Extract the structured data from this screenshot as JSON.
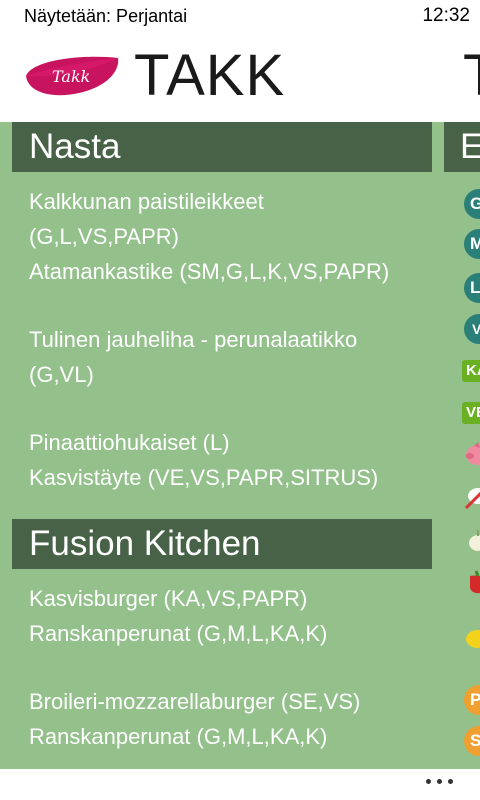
{
  "status_bar": {
    "left_text": "Näytetään: Perjantai",
    "time": "12:32"
  },
  "header": {
    "logo_text": "Takk",
    "title": "TAKK",
    "next_title": "T"
  },
  "sections": [
    {
      "title": "Nasta",
      "items": [
        {
          "lines": [
            "Kalkkunan paistileikkeet",
            "(G,L,VS,PAPR)",
            "Atamankastike (SM,G,L,K,VS,PAPR)"
          ]
        },
        {
          "lines": [
            "Tulinen jauheliha - perunalaatikko",
            "(G,VL)"
          ]
        },
        {
          "lines": [
            "Pinaattiohukaiset (L)",
            "Kasvistäyte (VE,VS,PAPR,SITRUS)"
          ]
        }
      ]
    },
    {
      "title": "Fusion Kitchen",
      "items": [
        {
          "lines": [
            "Kasvisburger (KA,VS,PAPR)",
            "Ranskanperunat (G,M,L,KA,K)"
          ]
        },
        {
          "lines": [
            "Broileri-mozzarellaburger (SE,VS)",
            "Ranskanperunat (G,M,L,KA,K)"
          ]
        }
      ]
    }
  ],
  "next_panel": {
    "title": "E",
    "badges": [
      {
        "text": "G",
        "color": "#2a7f78"
      },
      {
        "text": "M",
        "color": "#2a7f78"
      },
      {
        "text": "L",
        "color": "#2a7f78"
      },
      {
        "text": "VL",
        "color": "#2a7f78"
      },
      {
        "text": "KA",
        "color": "#6ab023"
      },
      {
        "text": "VE",
        "color": "#6ab023"
      },
      {
        "text": "PÄ",
        "color": "#f0a030"
      },
      {
        "text": "SE",
        "color": "#f0a030"
      }
    ],
    "icons": [
      "pig-icon",
      "no-meat-icon",
      "garlic-icon",
      "pepper-icon",
      "lemon-icon"
    ]
  },
  "app_bar": {
    "more_icon": "ellipsis-icon"
  },
  "colors": {
    "content_bg": "#93c08b",
    "section_header_bg": "#476247",
    "text": "#ffffff"
  }
}
